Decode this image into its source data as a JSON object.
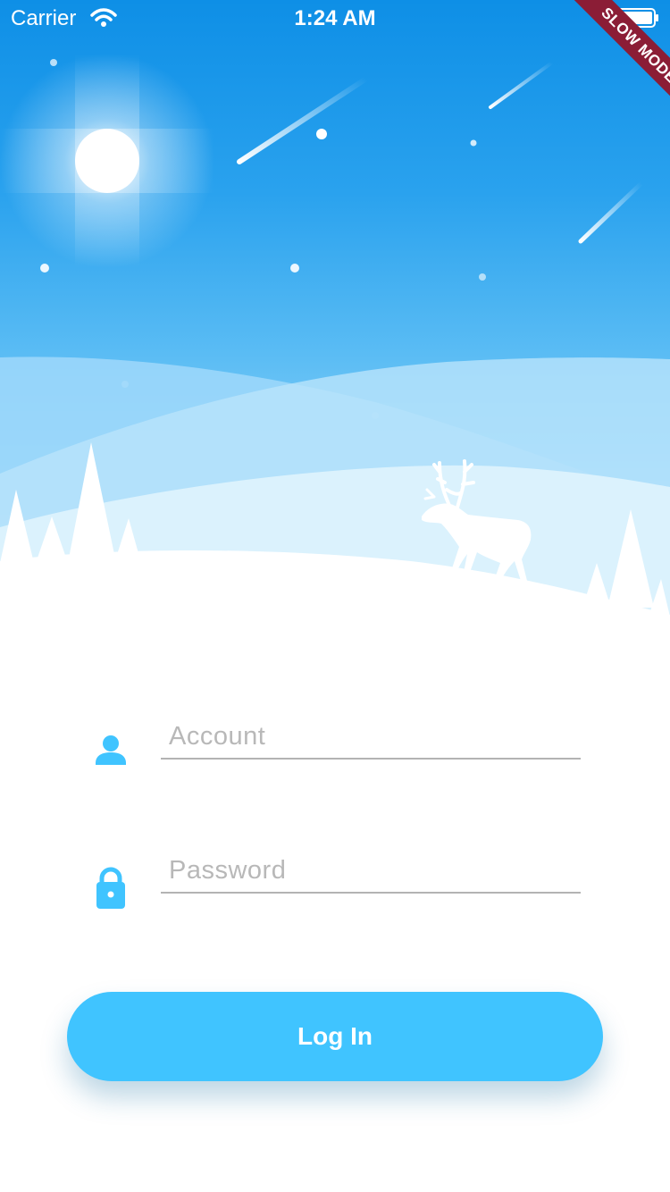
{
  "status_bar": {
    "carrier": "Carrier",
    "time": "1:24 AM"
  },
  "debug_banner": {
    "label": "SLOW MODE",
    "color": "#8b1d36"
  },
  "icons": {
    "wifi": "wifi-icon",
    "battery": "battery-icon",
    "account": "person-icon",
    "password": "lock-icon",
    "sun": "sun-icon",
    "reindeer": "reindeer-illustration"
  },
  "form": {
    "account": {
      "placeholder": "Account",
      "value": ""
    },
    "password": {
      "placeholder": "Password",
      "value": ""
    },
    "login_label": "Log In"
  },
  "colors": {
    "accent": "#40c4ff",
    "sky_top": "#0e8fe6",
    "sky_bottom": "#c8ebfc"
  }
}
